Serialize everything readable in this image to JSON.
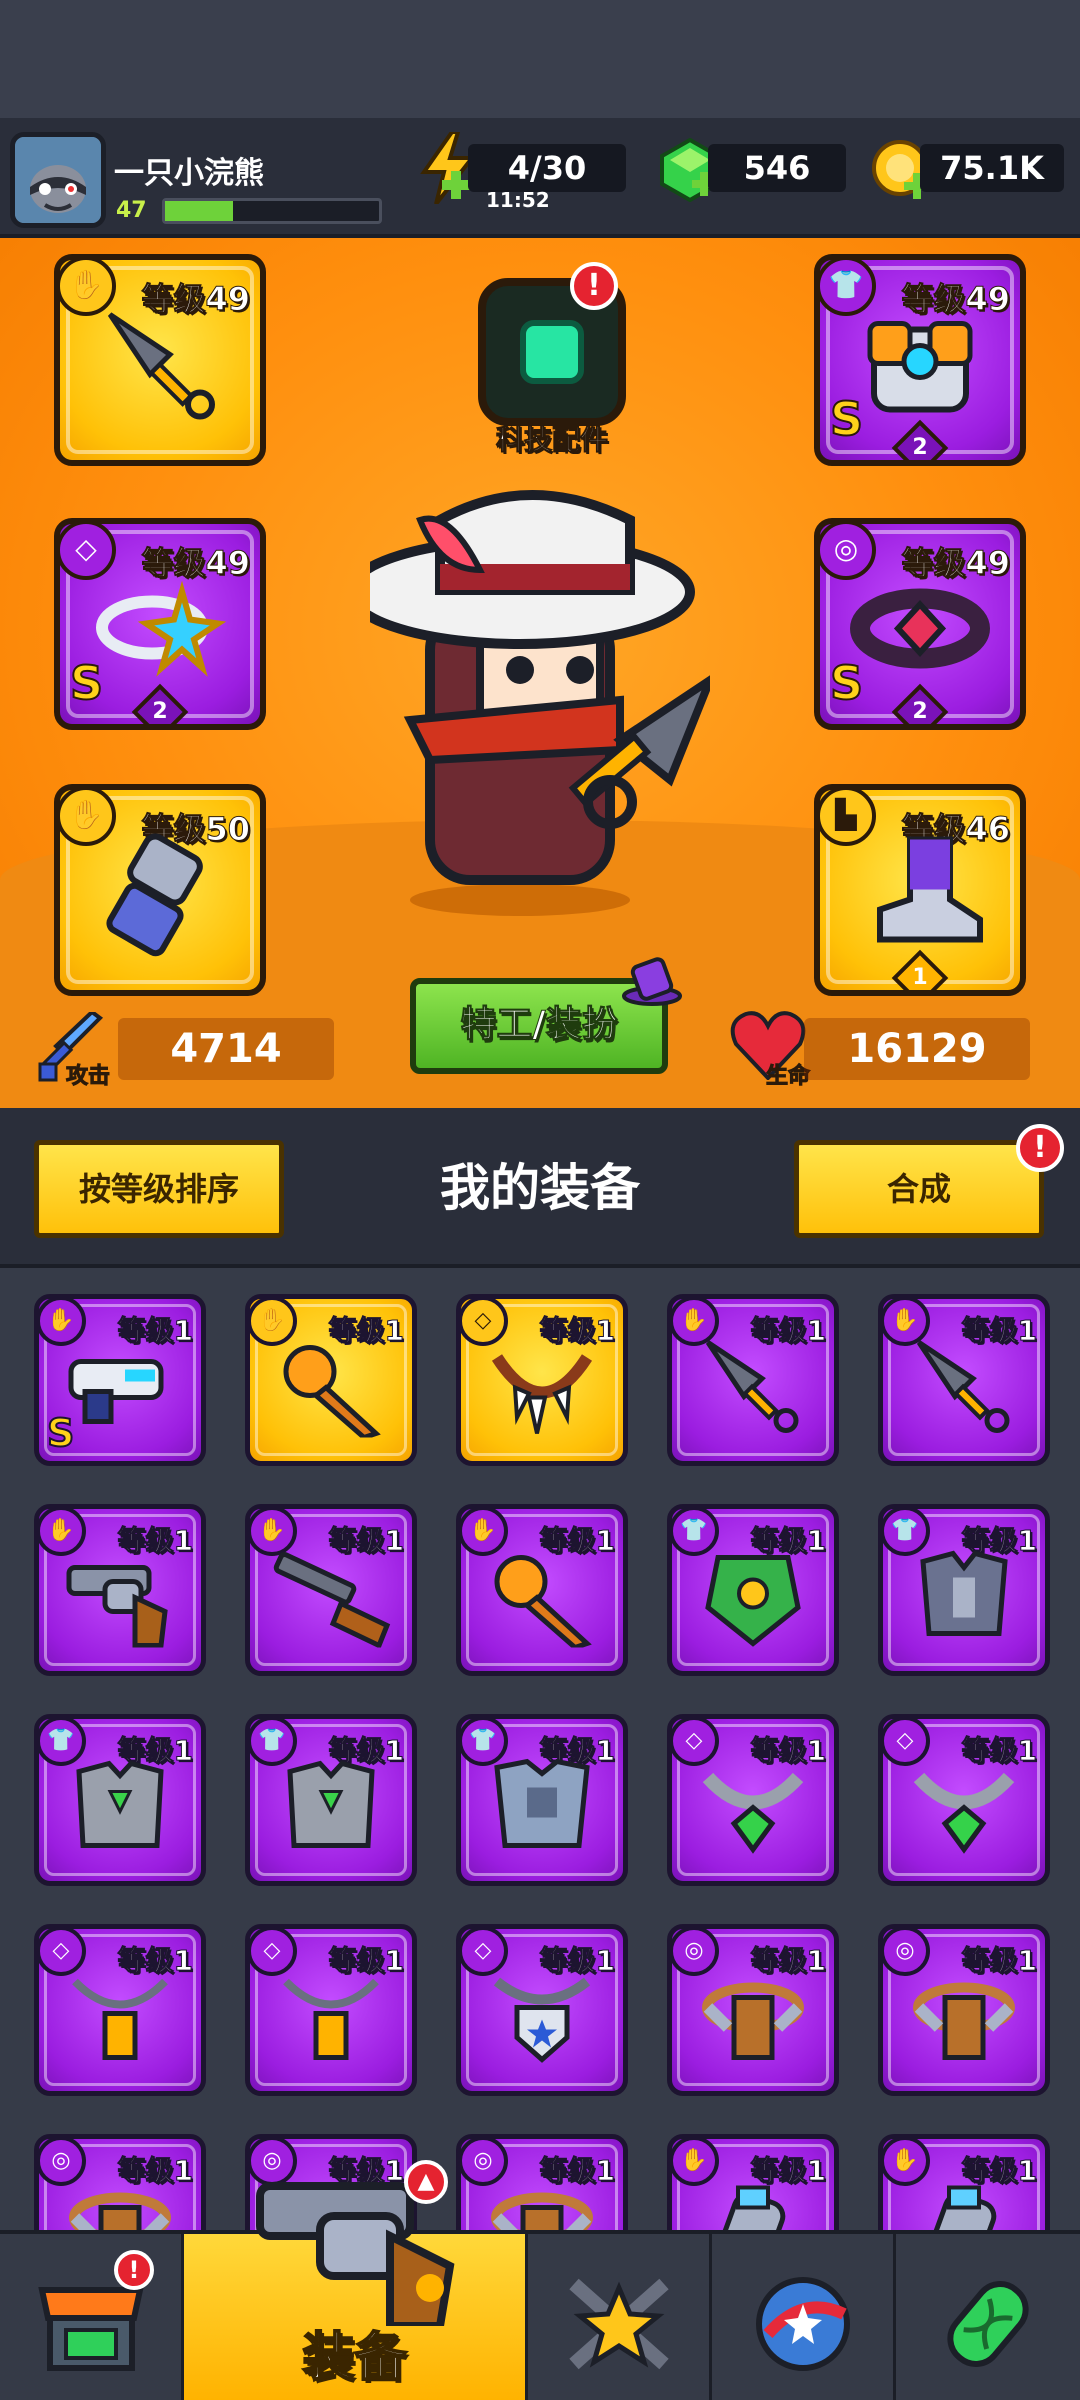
{
  "player": {
    "name": "一只小浣熊",
    "level": "47",
    "xp_fraction": 0.32
  },
  "resources": {
    "energy": {
      "value": "4/30",
      "timer": "11:52"
    },
    "gems": {
      "value": "546"
    },
    "coins": {
      "value": "75.1K"
    }
  },
  "equipped": {
    "weapon": {
      "level": "等级49",
      "rank": "",
      "stars": ""
    },
    "armor": {
      "level": "等级49",
      "rank": "S",
      "stars": "2"
    },
    "ring": {
      "level": "等级49",
      "rank": "S",
      "stars": "2"
    },
    "belt": {
      "level": "等级49",
      "rank": "S",
      "stars": "2"
    },
    "glove": {
      "level": "等级50",
      "rank": "",
      "stars": ""
    },
    "boots": {
      "level": "等级46",
      "rank": "",
      "stars": "1"
    }
  },
  "tech": {
    "label": "科技配件",
    "alert": "!"
  },
  "agent_button": "特工/装扮",
  "stats": {
    "attack": {
      "label": "攻击",
      "value": "4714"
    },
    "hp": {
      "label": "生命",
      "value": "16129"
    }
  },
  "inventory_header": {
    "sort_label": "按等级排序",
    "title": "我的装备",
    "merge_label": "合成",
    "merge_alert": "!"
  },
  "inventory": [
    {
      "level": "等级1",
      "rarity": "purple",
      "slot": "weapon",
      "icon": "blaster-icon",
      "rank": "S"
    },
    {
      "level": "等级1",
      "rarity": "gold",
      "slot": "weapon",
      "icon": "mic-icon",
      "rank": ""
    },
    {
      "level": "等级1",
      "rarity": "gold",
      "slot": "necklace",
      "icon": "fang-necklace-icon",
      "rank": ""
    },
    {
      "level": "等级1",
      "rarity": "purple",
      "slot": "weapon",
      "icon": "kunai-icon",
      "rank": ""
    },
    {
      "level": "等级1",
      "rarity": "purple",
      "slot": "weapon",
      "icon": "kunai-icon",
      "rank": ""
    },
    {
      "level": "等级1",
      "rarity": "purple",
      "slot": "weapon",
      "icon": "revolver-icon",
      "rank": ""
    },
    {
      "level": "等级1",
      "rarity": "purple",
      "slot": "weapon",
      "icon": "shotgun-icon",
      "rank": ""
    },
    {
      "level": "等级1",
      "rarity": "purple",
      "slot": "weapon",
      "icon": "mic-icon",
      "rank": ""
    },
    {
      "level": "等级1",
      "rarity": "purple",
      "slot": "armor",
      "icon": "leaf-armor-icon",
      "rank": ""
    },
    {
      "level": "等级1",
      "rarity": "purple",
      "slot": "armor",
      "icon": "plate-armor-icon",
      "rank": ""
    },
    {
      "level": "等级1",
      "rarity": "purple",
      "slot": "armor",
      "icon": "vest-icon",
      "rank": ""
    },
    {
      "level": "等级1",
      "rarity": "purple",
      "slot": "armor",
      "icon": "vest-icon",
      "rank": ""
    },
    {
      "level": "等级1",
      "rarity": "purple",
      "slot": "armor",
      "icon": "chest-armor-icon",
      "rank": ""
    },
    {
      "level": "等级1",
      "rarity": "purple",
      "slot": "necklace",
      "icon": "gem-necklace-icon",
      "rank": ""
    },
    {
      "level": "等级1",
      "rarity": "purple",
      "slot": "necklace",
      "icon": "gem-necklace-icon",
      "rank": ""
    },
    {
      "level": "等级1",
      "rarity": "purple",
      "slot": "necklace",
      "icon": "lantern-necklace-icon",
      "rank": ""
    },
    {
      "level": "等级1",
      "rarity": "purple",
      "slot": "necklace",
      "icon": "lantern-necklace-icon",
      "rank": ""
    },
    {
      "level": "等级1",
      "rarity": "purple",
      "slot": "necklace",
      "icon": "shield-necklace-icon",
      "rank": ""
    },
    {
      "level": "等级1",
      "rarity": "purple",
      "slot": "belt",
      "icon": "belt-icon",
      "rank": ""
    },
    {
      "level": "等级1",
      "rarity": "purple",
      "slot": "belt",
      "icon": "belt-icon",
      "rank": ""
    },
    {
      "level": "等级1",
      "rarity": "purple",
      "slot": "belt",
      "icon": "belt-icon",
      "rank": ""
    },
    {
      "level": "等级1",
      "rarity": "purple",
      "slot": "belt",
      "icon": "belt-icon",
      "rank": ""
    },
    {
      "level": "等级1",
      "rarity": "purple",
      "slot": "belt",
      "icon": "belt-icon",
      "rank": ""
    },
    {
      "level": "等级1",
      "rarity": "purple",
      "slot": "glove",
      "icon": "glove-icon",
      "rank": ""
    },
    {
      "level": "等级1",
      "rarity": "purple",
      "slot": "glove",
      "icon": "glove-icon",
      "rank": ""
    }
  ],
  "nav": {
    "shop": {
      "icon": "shop-icon",
      "alert": "!"
    },
    "equipment": {
      "label": "装备",
      "icon": "revolver-icon"
    },
    "battle": {
      "icon": "crossed-swords-star-icon"
    },
    "event": {
      "icon": "star-ball-icon"
    },
    "lab": {
      "icon": "dna-capsule-icon"
    }
  },
  "colors": {
    "hero_bg": "#ff8f0e",
    "purple_item": "#9b1de0",
    "gold_item": "#ffc107",
    "green_button": "#4fb424"
  }
}
